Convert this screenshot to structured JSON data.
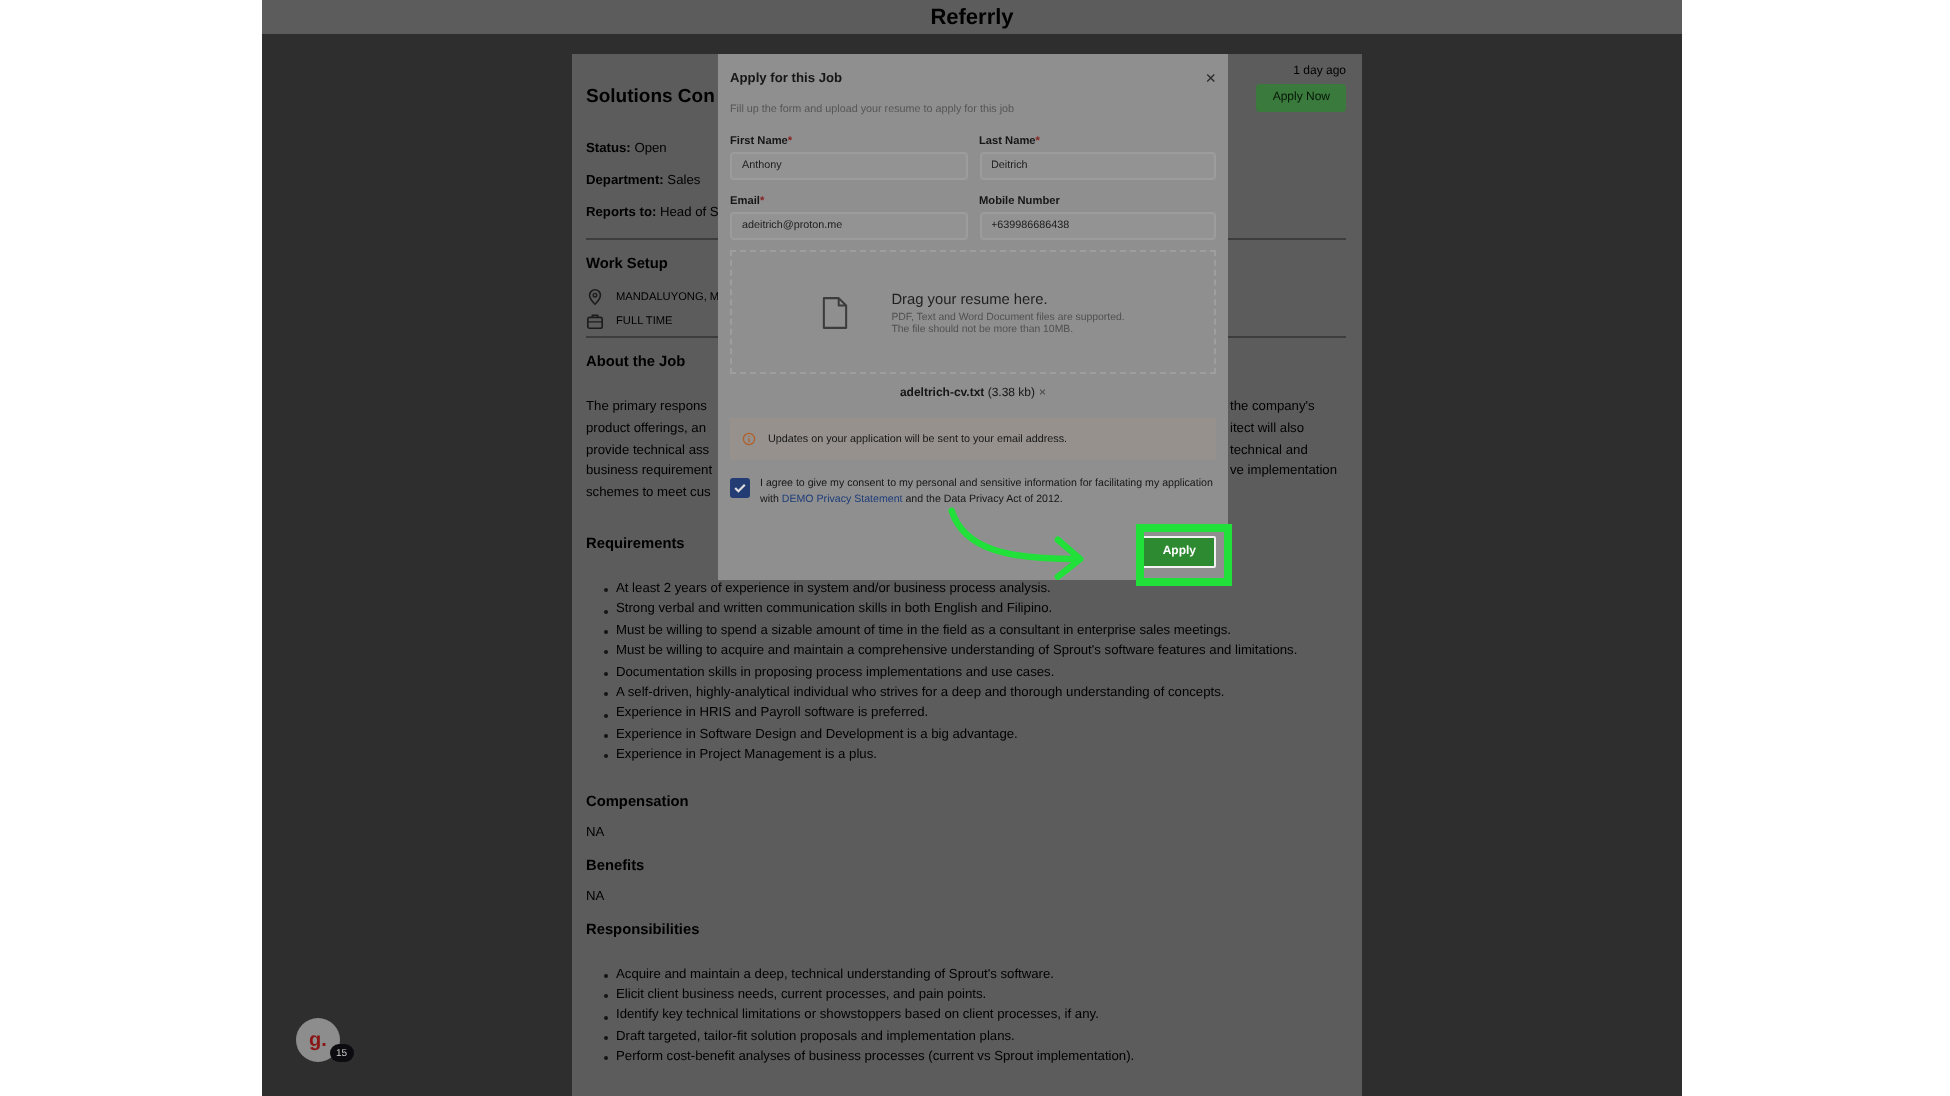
{
  "header": {
    "title": "Referrly"
  },
  "job": {
    "title": "Solutions Con",
    "posted": "1 day ago",
    "apply_button": "Apply Now",
    "facts": [
      {
        "label": "Status:",
        "value": "Open"
      },
      {
        "label": "Department:",
        "value": "Sales"
      },
      {
        "label": "Reports to:",
        "value": "Head of S"
      }
    ],
    "work_setup": {
      "heading": "Work Setup",
      "items": [
        {
          "kind": "location",
          "text": "MANDALUYONG, M"
        },
        {
          "kind": "employment",
          "text": "FULL TIME"
        }
      ]
    },
    "about": {
      "heading": "About the Job",
      "lines": [
        {
          "left": "The primary respons",
          "right": "the company's"
        },
        {
          "left": "product offerings, an",
          "right": "itect will also"
        },
        {
          "left": "provide technical ass",
          "right": "technical and"
        },
        {
          "left": "business requirement",
          "right": "ve implementation"
        },
        {
          "left": "schemes to meet cus"
        }
      ]
    },
    "sections": [
      {
        "kind": "list",
        "heading": "Requirements",
        "items": [
          "At least 2 years of experience in system and/or business process analysis.",
          "Strong verbal and written communication skills in both English and Filipino.",
          "Must be willing to spend a sizable amount of time in the field as a consultant in enterprise sales meetings.",
          "Must be willing to acquire and maintain a comprehensive understanding of Sprout's software features and limitations.",
          "Documentation skills in proposing process implementations and use cases.",
          "A self-driven, highly-analytical individual who strives for a deep and thorough understanding of concepts.",
          "Experience in HRIS and Payroll software is preferred.",
          "Experience in Software Design and Development is a big advantage.",
          "Experience in Project Management is a plus."
        ]
      },
      {
        "kind": "text",
        "heading": "Compensation",
        "text": "NA"
      },
      {
        "kind": "text",
        "heading": "Benefits",
        "text": "NA"
      },
      {
        "kind": "list",
        "heading": "Responsibilities",
        "items": [
          "Acquire and maintain a deep, technical understanding of Sprout's software.",
          "Elicit client business needs, current processes, and pain points.",
          "Identify key technical limitations or showstoppers based on client processes, if any.",
          "Draft targeted, tailor-fit solution proposals and implementation plans.",
          "Perform cost-benefit analyses of business processes (current vs Sprout implementation)."
        ]
      }
    ]
  },
  "dialog": {
    "title": "Apply for this Job",
    "close": "×",
    "subtitle": "Fill up the form and upload your resume to apply for this job",
    "required_mark": "*",
    "fields": [
      {
        "label": "First Name",
        "required": true,
        "value": "Anthony"
      },
      {
        "label": "Last Name",
        "required": true,
        "value": "Deitrich"
      },
      {
        "label": "Email",
        "required": true,
        "value": "adeitrich@proton.me"
      },
      {
        "label": "Mobile Number",
        "required": false,
        "value": "+639986686438"
      }
    ],
    "dropzone": {
      "title": "Drag your resume here.",
      "hints": [
        "PDF, Text and Word Document files are supported.",
        "The file should not be more than 10MB."
      ]
    },
    "file": {
      "name": "adeltrich-cv.txt",
      "size": "(3.38 kb)",
      "remove": "×"
    },
    "notice": "Updates on your application will be sent to your email address.",
    "consent": {
      "checked": true,
      "before": "I agree to give my consent to my personal and sensitive information for facilitating my application with ",
      "link": "DEMO Privacy Statement",
      "after": " and the Data Privacy Act of 2012."
    },
    "submit": "Apply"
  },
  "user": {
    "avatar": "g.",
    "badge": "15"
  }
}
